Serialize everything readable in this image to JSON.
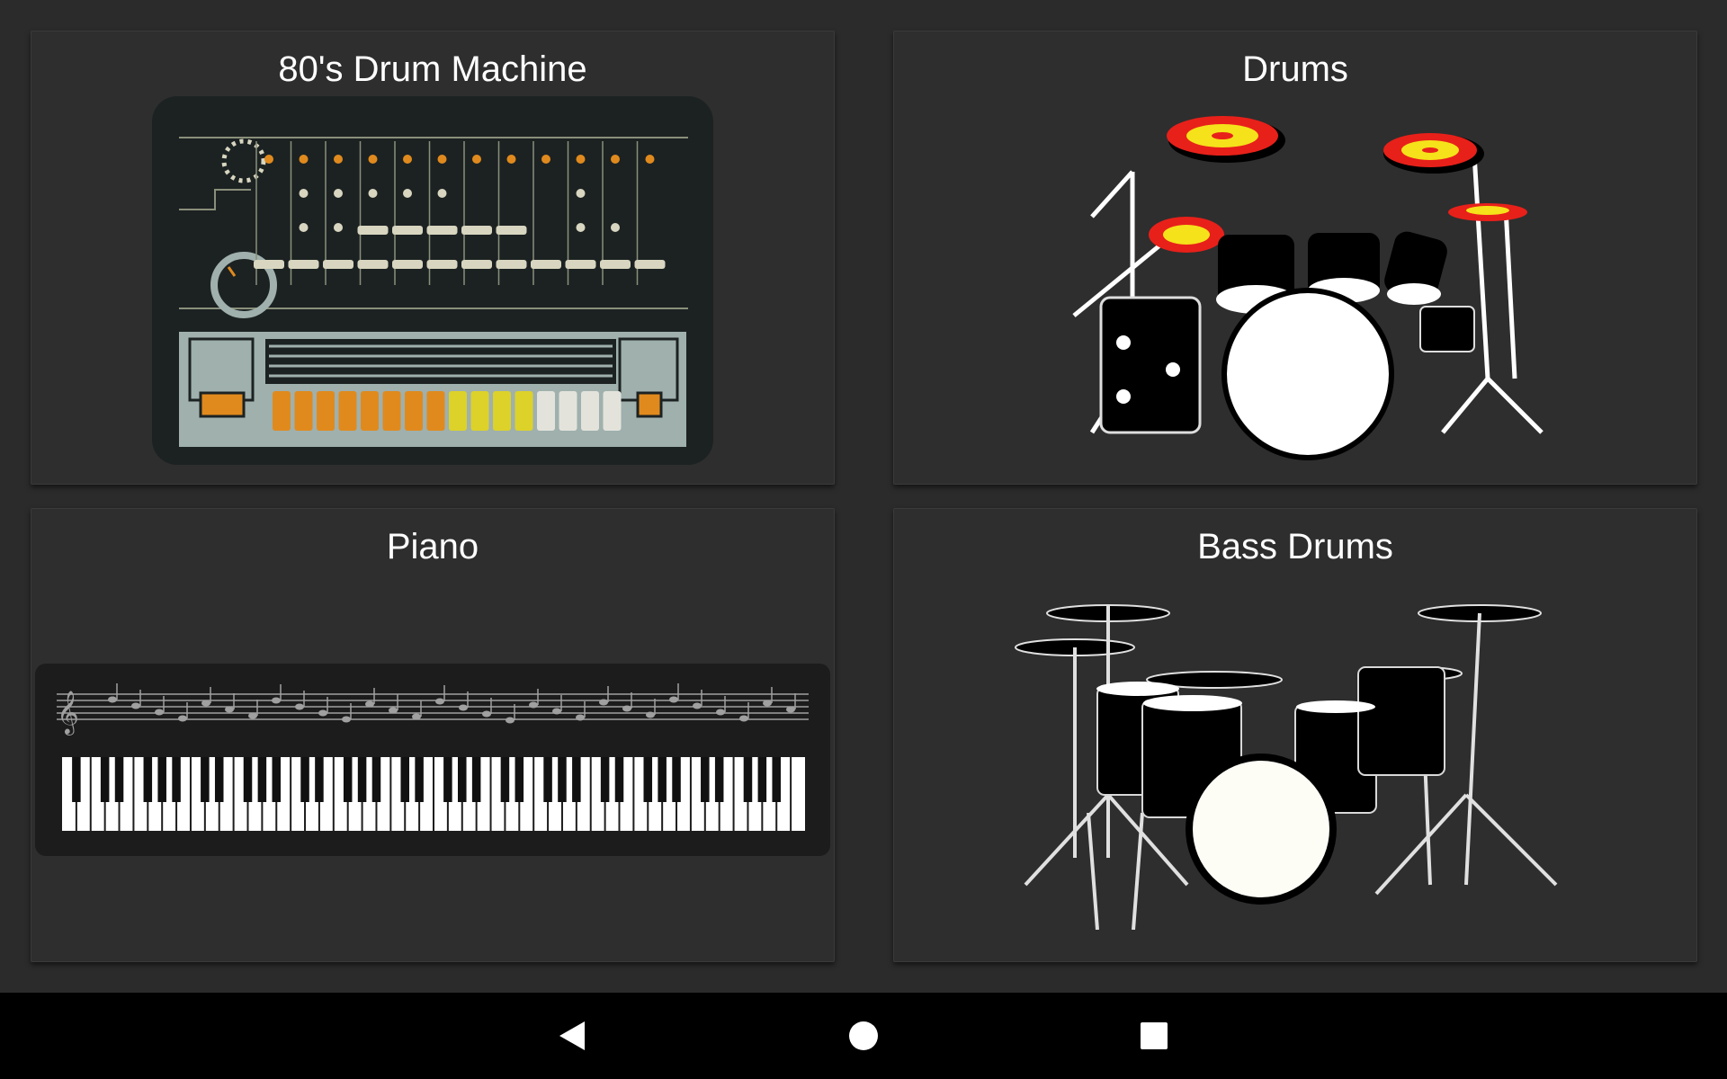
{
  "instruments": [
    {
      "title": "80's Drum Machine",
      "image": "drum-machine-illustration"
    },
    {
      "title": "Drums",
      "image": "drum-kit-red-cymbals-illustration"
    },
    {
      "title": "Piano",
      "image": "piano-keyboard-with-staff-illustration"
    },
    {
      "title": "Bass Drums",
      "image": "drum-kit-silhouette-illustration"
    }
  ],
  "navbar": {
    "back_icon": "back-triangle-icon",
    "home_icon": "home-circle-icon",
    "recents_icon": "recents-square-icon"
  },
  "colors": {
    "background": "#2b2b2b",
    "card": "#2e2e2e",
    "navbar": "#000000",
    "drum_machine_orange": "#e08a1e",
    "drum_machine_yellow": "#dcd22a",
    "cymbal_red": "#e8201a",
    "cymbal_yellow": "#f5e21a"
  }
}
